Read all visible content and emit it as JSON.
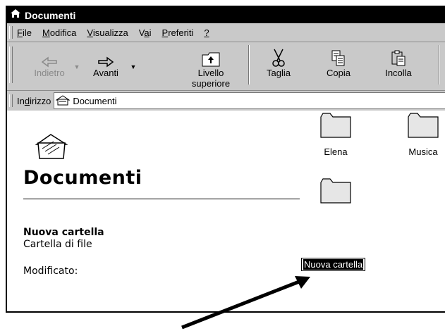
{
  "window": {
    "title": "Documenti"
  },
  "menubar": {
    "items": [
      {
        "label": "File",
        "key": "F",
        "rest": "ile"
      },
      {
        "label": "Modifica",
        "key": "M",
        "rest": "odifica"
      },
      {
        "label": "Visualizza",
        "key": "V",
        "rest": "isualizza"
      },
      {
        "label": "Vai",
        "pre": "V",
        "key": "a",
        "rest": "i"
      },
      {
        "label": "Preferiti",
        "key": "P",
        "rest": "referiti"
      },
      {
        "label": "?",
        "key": "?",
        "rest": ""
      }
    ]
  },
  "toolbar": {
    "back_label": "Indietro",
    "forward_label": "Avanti",
    "up_label_1": "Livello",
    "up_label_2": "superiore",
    "cut_label": "Taglia",
    "copy_label": "Copia",
    "paste_label": "Incolla"
  },
  "address": {
    "label_pre": "In",
    "label_key": "d",
    "label_rest": "irizzo",
    "value": "Documenti"
  },
  "panel": {
    "title": "Documenti",
    "selected_name": "Nuova cartella",
    "selected_type": "Cartella di file",
    "modified_label": "Modificato:"
  },
  "folders": [
    {
      "name": "Elena"
    },
    {
      "name": "Musica"
    }
  ],
  "rename": {
    "value": "Nuova cartella"
  }
}
